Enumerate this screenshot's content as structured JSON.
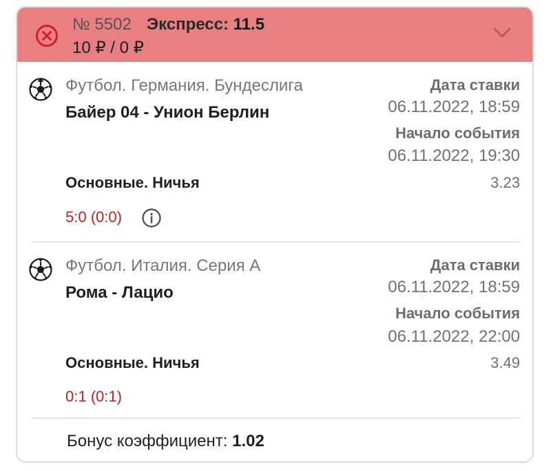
{
  "bet": {
    "number": "№ 5502",
    "type_label": "Экспресс:",
    "total_odds": "11.5",
    "amount": "10 ₽ / 0 ₽",
    "status_icon": "close-circle-icon",
    "expand_icon": "chevron-down-icon"
  },
  "events": [
    {
      "sport_icon": "soccer-ball-icon",
      "league": "Футбол. Германия. Бундеслига",
      "teams": "Байер 04 - Унион Берлин",
      "bet_date_label": "Дата ставки",
      "bet_date": "06.11.2022, 18:59",
      "start_label": "Начало события",
      "start_date": "06.11.2022, 19:30",
      "market": "Основные. Ничья",
      "odds": "3.23",
      "score": "5:0 (0:0)",
      "has_info": true
    },
    {
      "sport_icon": "soccer-ball-icon",
      "league": "Футбол. Италия. Серия А",
      "teams": "Рома - Лацио",
      "bet_date_label": "Дата ставки",
      "bet_date": "06.11.2022, 18:59",
      "start_label": "Начало события",
      "start_date": "06.11.2022, 22:00",
      "market": "Основные. Ничья",
      "odds": "3.49",
      "score": "0:1 (0:1)",
      "has_info": false
    }
  ],
  "bonus": {
    "label": "Бонус коэффициент:",
    "value": "1.02"
  },
  "colors": {
    "header_bg": "#e87f81",
    "loss_red": "#c81e1e",
    "status_icon_red": "#d21f2a"
  }
}
